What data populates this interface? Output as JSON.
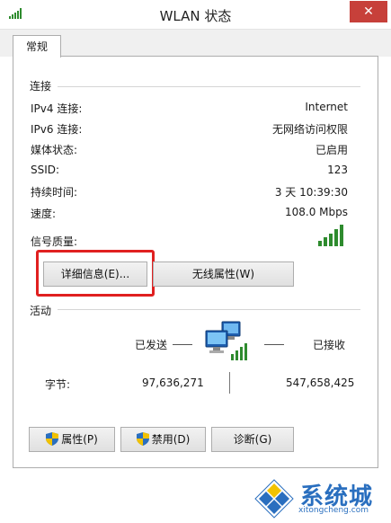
{
  "window": {
    "title": "WLAN 状态",
    "close_label": "✕"
  },
  "tabs": [
    {
      "label": "常规"
    }
  ],
  "connection": {
    "section_label": "连接",
    "rows": [
      {
        "label": "IPv4 连接:",
        "value": "Internet"
      },
      {
        "label": "IPv6 连接:",
        "value": "无网络访问权限"
      },
      {
        "label": "媒体状态:",
        "value": "已启用"
      },
      {
        "label": "SSID:",
        "value": "123"
      },
      {
        "label": "持续时间:",
        "value": "3 天 10:39:30"
      },
      {
        "label": "速度:",
        "value": "108.0 Mbps"
      }
    ],
    "signal_label": "信号质量:",
    "signal_bars": 5,
    "details_button": "详细信息(E)...",
    "wireless_props_button": "无线属性(W)"
  },
  "activity": {
    "section_label": "活动",
    "sent_label": "已发送",
    "received_label": "已接收",
    "bytes_label": "字节:",
    "bytes_sent": "97,636,271",
    "bytes_received": "547,658,425"
  },
  "buttons": {
    "properties": "属性(P)",
    "disable": "禁用(D)",
    "diagnose": "诊断(G)"
  },
  "watermark": {
    "text_cn": "系统城",
    "text_en": "xitongcheng.com"
  },
  "colors": {
    "close": "#c7403a",
    "signal": "#2e8b2e",
    "highlight": "#e02020",
    "watermark": "#2a6fbf"
  }
}
